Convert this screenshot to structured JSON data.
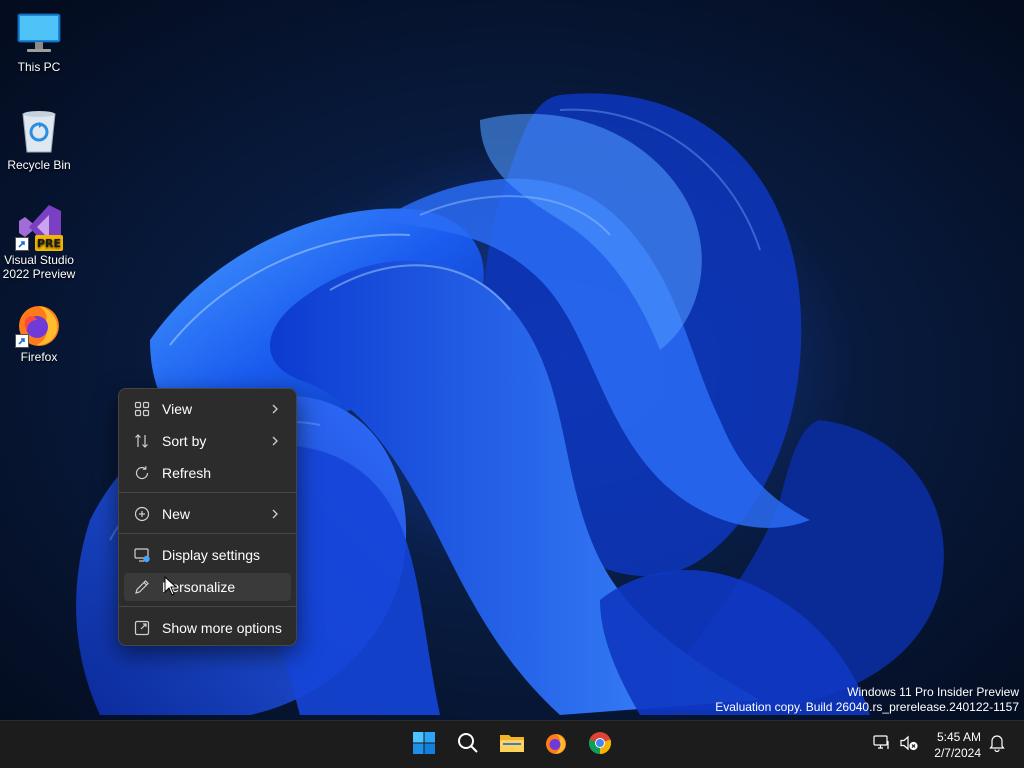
{
  "desktop": {
    "icons": [
      {
        "label": "This PC",
        "icon": "monitor-icon"
      },
      {
        "label": "Recycle Bin",
        "icon": "recycle-bin-icon"
      },
      {
        "label": "Visual Studio 2022 Preview",
        "line1": "Visual Studio",
        "line2": "2022 Preview",
        "badge": "PRE",
        "icon": "visual-studio-icon"
      },
      {
        "label": "Firefox",
        "icon": "firefox-icon"
      }
    ]
  },
  "context_menu": {
    "items": [
      {
        "label": "View",
        "icon": "grid-icon",
        "has_submenu": true
      },
      {
        "label": "Sort by",
        "icon": "sort-icon",
        "has_submenu": true
      },
      {
        "label": "Refresh",
        "icon": "refresh-icon",
        "has_submenu": false
      },
      {
        "label": "New",
        "icon": "plus-circle-icon",
        "has_submenu": true
      },
      {
        "label": "Display settings",
        "icon": "display-settings-icon",
        "has_submenu": false
      },
      {
        "label": "Personalize",
        "icon": "pen-icon",
        "has_submenu": false,
        "hovered": true
      },
      {
        "label": "Show more options",
        "icon": "share-icon",
        "has_submenu": false
      }
    ]
  },
  "watermark": {
    "line1": "Windows 11 Pro Insider Preview",
    "line2": "Evaluation copy. Build 26040.rs_prerelease.240122-1157"
  },
  "taskbar": {
    "apps": [
      "start-icon",
      "search-icon",
      "file-explorer-icon",
      "firefox-icon",
      "chrome-icon"
    ],
    "tray": [
      "network-icon",
      "volume-muted-icon"
    ],
    "clock": {
      "time": "5:45 AM",
      "date": "2/7/2024"
    },
    "notification": "bell-icon"
  },
  "colors": {
    "accent": "#0078d4",
    "menu_bg": "#2c2c2c",
    "taskbar_bg": "#1c1c1c"
  }
}
